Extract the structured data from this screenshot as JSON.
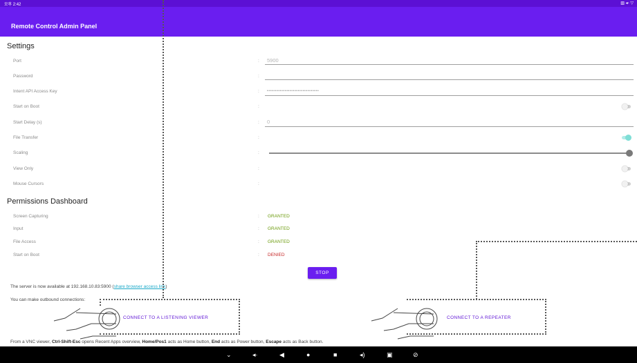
{
  "status_bar": {
    "time": "오후 2:42",
    "right_icons": "▥ ◂◦ ▽"
  },
  "app_bar": {
    "title": "Remote Control Admin Panel"
  },
  "settings": {
    "title": "Settings",
    "port": {
      "label": "Port",
      "value": "5900"
    },
    "password": {
      "label": "Password",
      "value": ""
    },
    "intent_key": {
      "label": "Intent API Access Key",
      "value": "••••••••••••••••••••••••••••••••"
    },
    "start_on_boot": {
      "label": "Start on Boot",
      "on": false
    },
    "start_delay": {
      "label": "Start Delay (s)",
      "value": "0"
    },
    "file_transfer": {
      "label": "File Transfer",
      "on": true
    },
    "scaling": {
      "label": "Scaling",
      "value": 1.0
    },
    "view_only": {
      "label": "View Only",
      "on": false
    },
    "mouse_cursors": {
      "label": "Mouse Cursors",
      "on": false
    },
    "colon": ":"
  },
  "permissions": {
    "title": "Permissions Dashboard",
    "screen_capturing": {
      "label": "Screen Capturing",
      "status": "GRANTED"
    },
    "input": {
      "label": "Input",
      "status": "GRANTED"
    },
    "file_access": {
      "label": "File Access",
      "status": "GRANTED"
    },
    "start_on_boot": {
      "label": "Start on Boot",
      "status": "DENIED"
    }
  },
  "stop_button": "STOP",
  "info": {
    "server_prefix": "The server is now available at 192.168.10.83:5900 (",
    "browser_link": "share browser access link",
    "server_suffix": ")",
    "outbound": "You can make outbound connections:",
    "vnc_a": "From a VNC viewer, ",
    "vnc_b": "Ctrl-Shift-Esc",
    "vnc_c": " opens Recent Apps overview, ",
    "vnc_d": "Home/Pos1",
    "vnc_e": " acts as Home button, ",
    "vnc_f": "End",
    "vnc_g": " acts as Power button, ",
    "vnc_h": "Escape",
    "vnc_i": " acts as Back button."
  },
  "connect_viewer": "CONNECT TO A LISTENING VIEWER",
  "connect_repeater": "CONNECT TO A REPEATER",
  "nav_bar": {
    "icons": [
      "chevron-down-icon",
      "volume-down-icon",
      "back-icon",
      "home-icon",
      "recents-icon",
      "volume-up-icon",
      "camera-icon",
      "rotate-icon"
    ]
  },
  "colors": {
    "accent": "#6a1ef0",
    "status_bar": "#5c10d4",
    "granted": "#6a9a0a",
    "denied": "#c62828",
    "toggle_on": "#7fded6"
  }
}
